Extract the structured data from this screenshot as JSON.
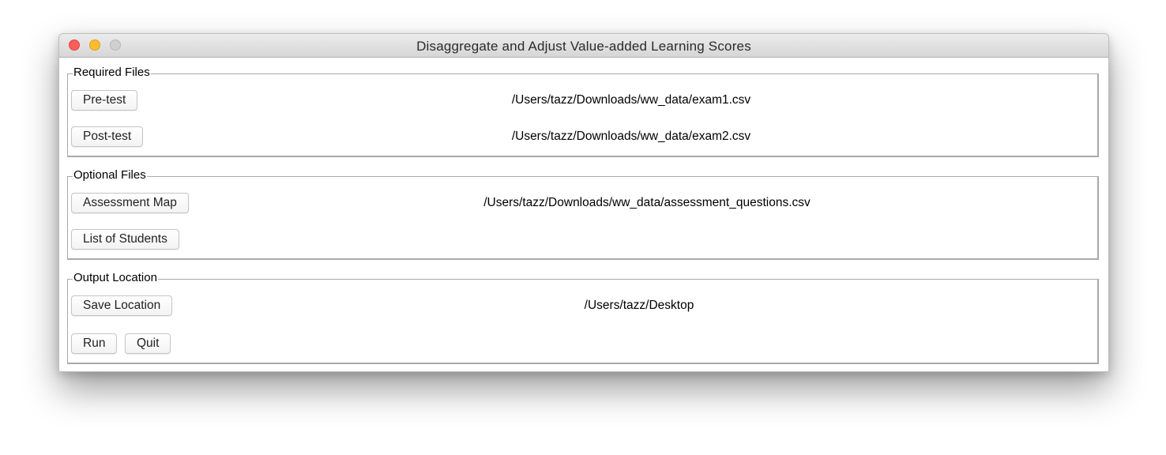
{
  "window": {
    "title": "Disaggregate and Adjust Value-added Learning Scores"
  },
  "required_files": {
    "label": "Required Files",
    "pretest_button": "Pre-test",
    "pretest_path": "/Users/tazz/Downloads/ww_data/exam1.csv",
    "posttest_button": "Post-test",
    "posttest_path": "/Users/tazz/Downloads/ww_data/exam2.csv"
  },
  "optional_files": {
    "label": "Optional Files",
    "assessment_map_button": "Assessment Map",
    "assessment_map_path": "/Users/tazz/Downloads/ww_data/assessment_questions.csv",
    "students_button": "List of Students",
    "students_path": ""
  },
  "output_location": {
    "label": "Output Location",
    "save_button": "Save Location",
    "save_path": "/Users/tazz/Desktop",
    "run_button": "Run",
    "quit_button": "Quit"
  },
  "colors": {
    "close": "#fc5f57",
    "minimize": "#fdbc2e",
    "zoom_disabled": "#d0d0d0"
  }
}
